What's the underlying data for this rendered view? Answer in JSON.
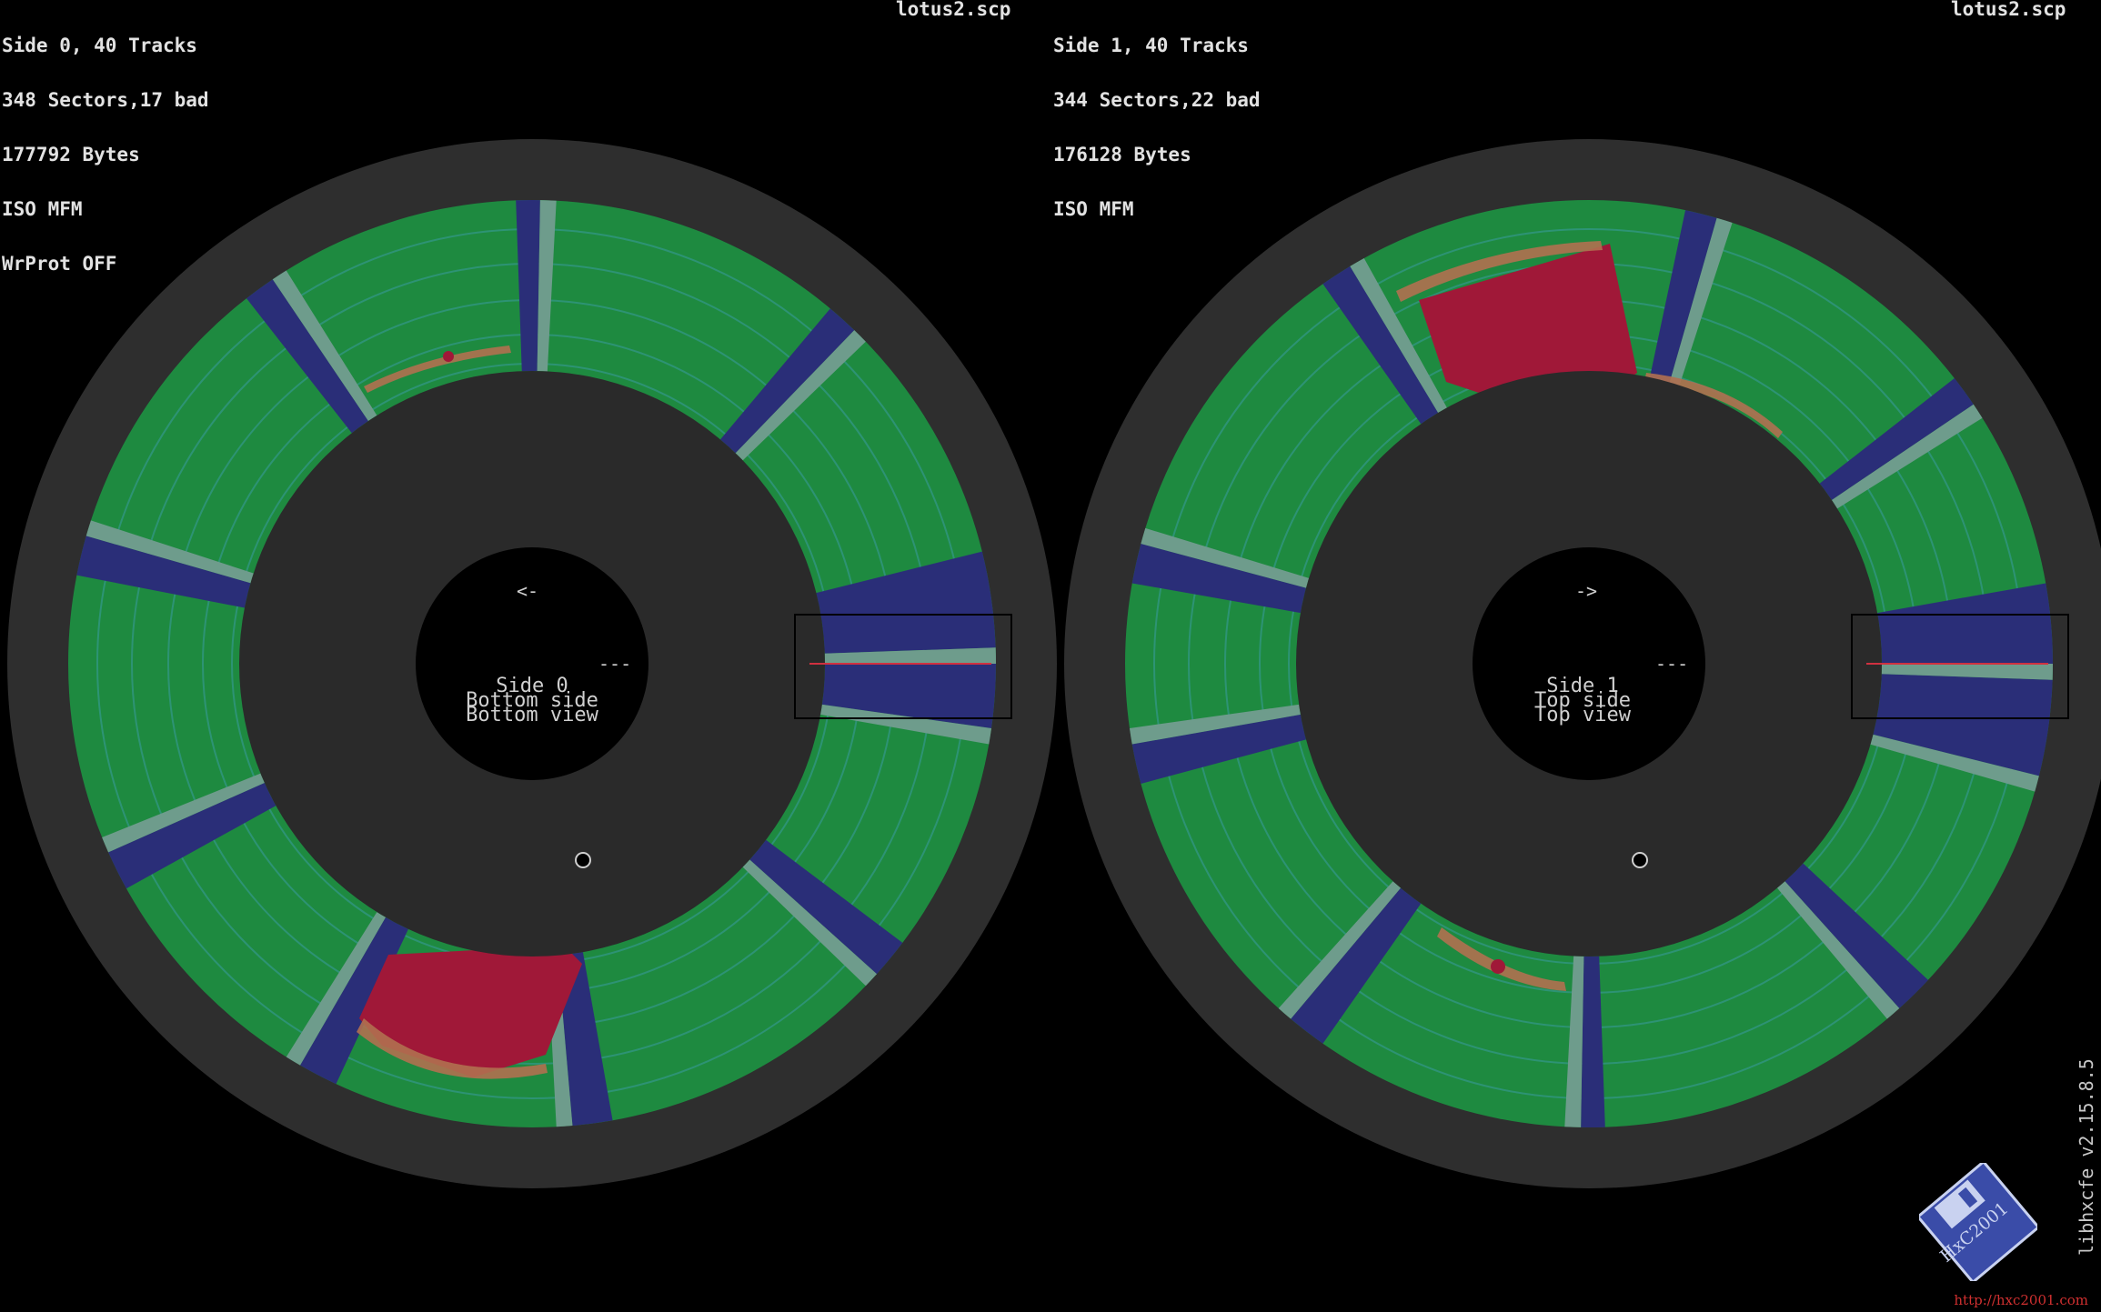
{
  "left_panel": {
    "info_lines": [
      "Side 0, 40 Tracks",
      "348 Sectors,17 bad",
      "177792 Bytes",
      "ISO MFM",
      "WrProt OFF"
    ],
    "filename": "lotus2.scp",
    "center_lines": [
      "Side 0",
      "Bottom side",
      "Bottom view"
    ],
    "direction": "<-",
    "track_mark": "---"
  },
  "right_panel": {
    "info_lines": [
      "Side 1, 40 Tracks",
      "344 Sectors,22 bad",
      "176128 Bytes",
      "ISO MFM"
    ],
    "filename": "lotus2.scp",
    "center_lines": [
      "Side 1",
      "Top side",
      "Top view"
    ],
    "direction": "->",
    "track_mark": "---"
  },
  "footer": {
    "version": "libhxcfe v2.15.8.5",
    "url": "http://hxc2001.com",
    "logo_text": "HxC2001"
  },
  "colors": {
    "background": "#000000",
    "disk_outer": "#2e2e2e",
    "hub": "#2a2a2a",
    "sector_ok": "#1e8a40",
    "sector_gap": "#2a2e78",
    "sector_gap_edge": "#6e9c8c",
    "bad_sector": "#a01838",
    "track_orange": "#b07050",
    "text": "#e2e2e2"
  }
}
